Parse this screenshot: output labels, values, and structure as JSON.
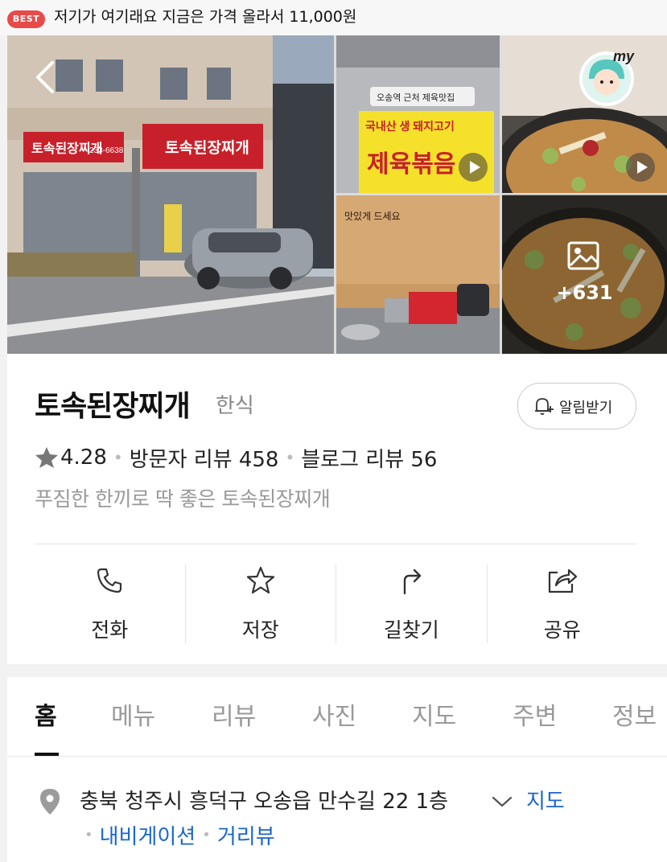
{
  "top_banner": {
    "badge": "BEST",
    "text": "저기가 여기래요 지금은 가격 올라서 11,000원"
  },
  "gallery": {
    "more_count": "+631",
    "photo_sign_1": "토속된장찌개",
    "photo_sign_phone": "233-6638",
    "photo_sign_2": "오송역 근처 제육맛집",
    "photo_sign_3": "국내산 생 돼지고기",
    "photo_sign_4": "제육볶음",
    "photo_sign_5": "맛있게 드세요"
  },
  "place": {
    "name": "토속된장찌개",
    "category": "한식",
    "alarm_label": "알림받기",
    "rating": "4.28",
    "visitor_reviews": "방문자 리뷰 458",
    "blog_reviews": "블로그 리뷰 56",
    "description": "푸짐한 한끼로 딱 좋은 토속된장찌개"
  },
  "actions": [
    {
      "label": "전화",
      "icon": "phone-icon"
    },
    {
      "label": "저장",
      "icon": "star-icon"
    },
    {
      "label": "길찾기",
      "icon": "directions-icon"
    },
    {
      "label": "공유",
      "icon": "share-icon"
    }
  ],
  "tabs": [
    "홈",
    "메뉴",
    "리뷰",
    "사진",
    "지도",
    "주변",
    "정보"
  ],
  "active_tab": "홈",
  "address": {
    "text": "충북 청주시 흥덕구 오송읍 만수길 22 1층",
    "map_link": "지도",
    "navigation_link": "내비게이션",
    "streetview_link": "거리뷰"
  },
  "colors": {
    "best_badge": "#e84a4a",
    "link_blue": "#1a66cc",
    "sign_red": "#c8202a",
    "sign_yellow": "#f5e12a"
  }
}
